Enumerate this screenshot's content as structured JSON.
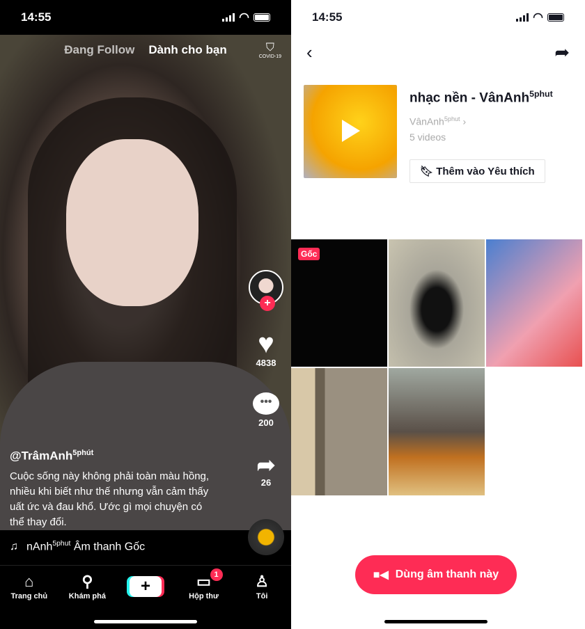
{
  "left": {
    "status": {
      "time": "14:55"
    },
    "tabs": {
      "following": "Đang Follow",
      "for_you": "Dành cho bạn"
    },
    "covid_label": "COVID-19",
    "actions": {
      "likes": "4838",
      "comments": "200",
      "shares": "26"
    },
    "caption": {
      "username": "@TrâmAnh",
      "username_sup": "5phút",
      "text": "Cuộc sống này không phải toàn màu hồng, nhiều khi biết như thế nhưng vẫn cảm thấy uất ức và đau khổ. Ước gì mọi chuyện có thể thay đổi."
    },
    "music": {
      "prefix": "nAnh",
      "sup": "5phut",
      "title": "Âm thanh Gốc"
    },
    "nav": [
      {
        "label": "Trang chủ",
        "icon": "home-icon"
      },
      {
        "label": "Khám phá",
        "icon": "search-icon"
      },
      {
        "label": "",
        "icon": "plus-icon"
      },
      {
        "label": "Hộp thư",
        "icon": "inbox-icon",
        "badge": "1"
      },
      {
        "label": "Tôi",
        "icon": "profile-icon"
      }
    ]
  },
  "right": {
    "status": {
      "time": "14:55"
    },
    "sound": {
      "title": "nhạc nền - VânAnh",
      "title_sup": "5phut",
      "author": "VânAnh",
      "author_sup": "5phut",
      "count": "5  videos",
      "favorite_label": "Thêm vào Yêu thích"
    },
    "original_badge": "Gốc",
    "use_button": "Dùng âm thanh này",
    "accent": "#fe2c55"
  }
}
